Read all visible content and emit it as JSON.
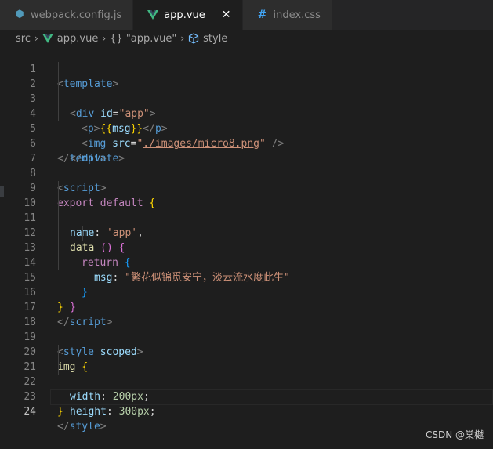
{
  "tabs": [
    {
      "label": "webpack.config.js",
      "icon": "webpack-icon"
    },
    {
      "label": "app.vue",
      "icon": "vue-icon",
      "active": true
    },
    {
      "label": "index.css",
      "icon": "css-hash-icon"
    }
  ],
  "breadcrumb": {
    "folder": "src",
    "file": "app.vue",
    "section": "{} \"app.vue\"",
    "symbol": "style"
  },
  "line_numbers": [
    "1",
    "2",
    "3",
    "4",
    "5",
    "6",
    "7",
    "8",
    "9",
    "10",
    "11",
    "12",
    "13",
    "14",
    "15",
    "16",
    "17",
    "18",
    "19",
    "20",
    "21",
    "22",
    "23",
    "24"
  ],
  "code": {
    "l1_open": "<",
    "l1_tag": "template",
    "l1_close": ">",
    "l2_open": "<",
    "l2_tag": "div",
    "l2_attr": "id",
    "l2_eq": "=",
    "l2_val": "\"app\"",
    "l2_close": ">",
    "l3_open": "<",
    "l3_tag": "p",
    "l3_gt": ">",
    "l3_lb": "{{",
    "l3_msg": "msg",
    "l3_rb": "}}",
    "l3_cl_open": "</",
    "l3_cl_tag": "p",
    "l3_cl": ">",
    "l4_open": "<",
    "l4_tag": "img",
    "l4_attr": "src",
    "l4_eq": "=",
    "l4_q1": "\"",
    "l4_path": "./images/micro8.png",
    "l4_q2": "\"",
    "l4_close": " />",
    "l5_open": "</",
    "l5_tag": "div",
    "l5_close": ">",
    "l6_open": "</",
    "l6_tag": "template",
    "l6_close": ">",
    "l8_open": "<",
    "l8_tag": "script",
    "l8_close": ">",
    "l9_export": "export",
    "l9_default": "default",
    "l9_brace": "{",
    "l10_key": "name",
    "l10_colon": ": ",
    "l10_val": "'app'",
    "l10_comma": ",",
    "l11_fn": "data",
    "l11_paren": "()",
    "l11_brace": "{",
    "l12_return": "return",
    "l12_brace": "{",
    "l13_key": "msg",
    "l13_colon": ": ",
    "l13_val": "\"繁花似锦觅安宁，淡云流水度此生\"",
    "l14_brace": "}",
    "l15_brace": "}",
    "l16_brace": "}",
    "l17_open": "</",
    "l17_tag": "script",
    "l17_close": ">",
    "l19_open": "<",
    "l19_tag": "style",
    "l19_attr": "scoped",
    "l19_close": ">",
    "l20_sel": "img",
    "l20_brace": "{",
    "l21_prop": "width",
    "l21_colon": ": ",
    "l21_val": "200px",
    "l21_semi": ";",
    "l22_prop": "height",
    "l22_colon": ": ",
    "l22_val": "300px",
    "l22_semi": ";",
    "l23_brace": "}",
    "l24_open": "</",
    "l24_tag": "style",
    "l24_close": ">"
  },
  "watermark": "CSDN @棠樾",
  "colors": {
    "background": "#1e1e1e",
    "tab_bar": "#252526",
    "tag": "#569cd6",
    "string": "#ce9178",
    "keyword": "#c586c0"
  }
}
